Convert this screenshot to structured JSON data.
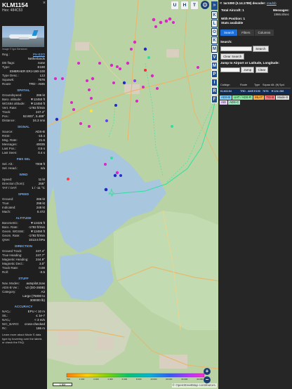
{
  "info": {
    "callsign": "KLM1154",
    "hex_label": "Hex: 484C53",
    "photo_credit": "Image © Igor Bersenev",
    "close": "×",
    "rows_basic": [
      {
        "label": "Reg.:",
        "value": "PH-EZO",
        "link": true
      },
      {
        "label": "",
        "value": "Netherlands",
        "link": false
      },
      {
        "label": "DB flags:",
        "value": "none",
        "link": false
      },
      {
        "label": "Type:",
        "value": "E190",
        "link": false
      },
      {
        "label": "",
        "value": "EMBRAER ERJ-190-100",
        "link": false
      },
      {
        "label": "Type Desc.:",
        "value": "L2J",
        "link": false
      },
      {
        "label": "Squawk:",
        "value": "7676",
        "link": false
      },
      {
        "label": "Route:",
        "value": "TRD - AMS",
        "link": false
      }
    ],
    "sections": [
      {
        "title": "SPATIAL",
        "rows": [
          {
            "label": "Groundspeed:",
            "value": "286 kt"
          },
          {
            "label": "Baro. altitude:",
            "value": "▼12450 ft"
          },
          {
            "label": "WGS84 altitude:",
            "value": "▼12450 ft"
          },
          {
            "label": "Vert. Rate:",
            "value": "-1792 ft/min"
          },
          {
            "label": "Track:",
            "value": "247.4°"
          },
          {
            "label": "Pos.:",
            "value": "52.803°, 5.489°"
          },
          {
            "label": "Distance:",
            "value": "24.3 nmi"
          }
        ]
      },
      {
        "title": "SIGNAL",
        "rows": [
          {
            "label": "Source:",
            "value": "ADS-B"
          },
          {
            "label": "RSSI:",
            "value": "-10.4"
          },
          {
            "label": "Msg. Rate:",
            "value": "21.6"
          },
          {
            "label": "Messages:",
            "value": "40035"
          },
          {
            "label": "Last Pos.:",
            "value": "0.5 s"
          },
          {
            "label": "Last Seen:",
            "value": "0.4 s"
          }
        ]
      },
      {
        "title": "FMS SEL",
        "rows": [
          {
            "label": "Sel. Alt.:",
            "value": "7008 ft"
          },
          {
            "label": "Sel. Head.:",
            "value": "n/a"
          }
        ]
      },
      {
        "title": "WIND",
        "rows": [
          {
            "label": "Speed:",
            "value": "11 kt"
          },
          {
            "label": "Direction (from):",
            "value": "255°"
          },
          {
            "label": "TAT / OAT:",
            "value": "1 / -11 °C"
          }
        ]
      },
      {
        "title": "SPEED",
        "rows": [
          {
            "label": "Ground:",
            "value": "286 kt"
          },
          {
            "label": "True:",
            "value": "298 kt"
          },
          {
            "label": "Indicated:",
            "value": "248 kt"
          },
          {
            "label": "Mach:",
            "value": "0.472"
          }
        ]
      },
      {
        "title": "ALTITUDE",
        "rows": [
          {
            "label": "Barometric:",
            "value": "▼12425 ft"
          },
          {
            "label": "Baro. Rate:",
            "value": "-1792 ft/min"
          },
          {
            "label": "Geom. WGS84:",
            "value": "▼12450 ft"
          },
          {
            "label": "Geom. Rate:",
            "value": "-1792 ft/min"
          },
          {
            "label": "QNH:",
            "value": "1013.6 hPa"
          }
        ]
      },
      {
        "title": "DIRECTION",
        "rows": [
          {
            "label": "Ground Track:",
            "value": "247.4°"
          },
          {
            "label": "True Heading:",
            "value": "247.7°"
          },
          {
            "label": "Magnetic Heading:",
            "value": "244.9°"
          },
          {
            "label": "Magnetic Decl.:",
            "value": "3.0°"
          },
          {
            "label": "Track Rate:",
            "value": "0.00"
          },
          {
            "label": "Roll:",
            "value": "-0.5"
          }
        ]
      },
      {
        "title": "STUFF",
        "rows": [
          {
            "label": "Nav. Modes:",
            "value": "autopilot,tcas"
          },
          {
            "label": "ADS-B Ver.:",
            "value": "v2 (DO-260B)"
          },
          {
            "label": "Category:",
            "value": "A3"
          },
          {
            "label": "",
            "value": "Large (75000 to"
          },
          {
            "label": "",
            "value": "300000 lb)"
          }
        ]
      },
      {
        "title": "ACCURACY",
        "rows": [
          {
            "label": "NACₚ:",
            "value": "EPU < 10 m"
          },
          {
            "label": "SIL:",
            "value": "≤ 1e-7"
          },
          {
            "label": "NACᵥ:",
            "value": "< 3 m/s"
          },
          {
            "label": "NIC_BARO:",
            "value": "cross-checked"
          },
          {
            "label": "Rc:",
            "value": "186 m"
          }
        ]
      }
    ],
    "footer": "Learn more about Mode S data type by hovering over the labels or check the FAQ."
  },
  "map": {
    "top_buttons": [
      "U",
      "H",
      "T"
    ],
    "side_buttons": [
      "K",
      "L",
      "O",
      "K",
      "M",
      "V",
      "M",
      "P",
      "I",
      "R",
      "F"
    ],
    "scale_text": "1 NM",
    "attribution": "© OpenStreetMap contributors.",
    "zoom_in": "+",
    "zoom_out": "−",
    "altitude_legend": [
      "500",
      "1 000",
      "2 000",
      "4 000",
      "6 000",
      "8 000",
      "10 000",
      "20 000",
      "30 000",
      "40 000+"
    ],
    "colors": {
      "water": "#a8c7de",
      "land": "#b9d3a5",
      "urban": "#d9cfc0",
      "road": "#e7b870",
      "track": "#4fe1a6"
    }
  },
  "right": {
    "arrow": "«",
    "version": "tar1090 (3.14.1789) decoder:",
    "version_link": "readsb",
    "total_aircraft_label": "Total Aircraft:",
    "total_aircraft_value": "1",
    "messages_label": "Messages:",
    "messages_value": "1966.8/sec",
    "with_position_label": "With Position:",
    "with_position_value": "1",
    "stats_label": "Stats available",
    "tabs": [
      "Search",
      "Filters",
      "Columns"
    ],
    "search_label": "Search:",
    "search_button": "Search",
    "clear_search": "Clear Search",
    "jump_label": "Jump to Airport or Latitude, Longitude:",
    "jump_button": "Jump",
    "clear_button": "Clear",
    "table_headers": [
      "Callsign",
      "Route",
      "Type",
      "Squawk",
      "Alt. (ft)",
      "Spd. (kt)"
    ],
    "table_row": [
      "KLM1154",
      "TRD - AMS",
      "E190",
      "7676",
      "▼12425",
      "286"
    ],
    "badges": [
      "ADS-B",
      "UAT / ADS-R",
      "MLAT",
      "TIS-B",
      "Mode-S",
      "AIS",
      "ADS-C"
    ]
  }
}
